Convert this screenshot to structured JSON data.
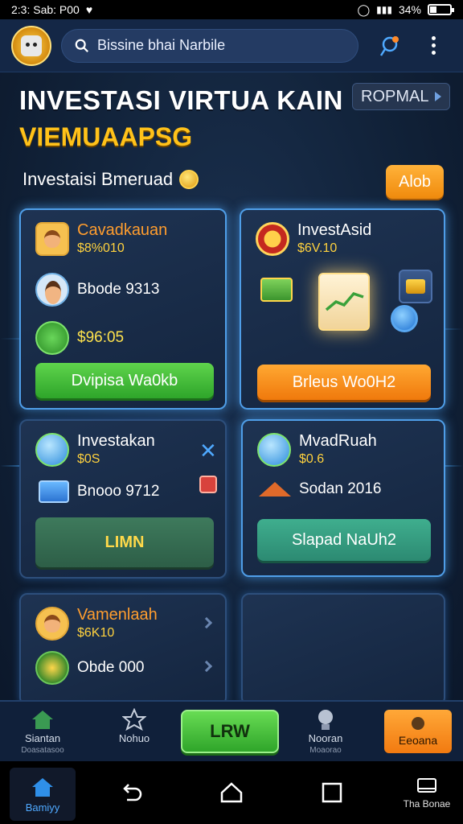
{
  "status_bar": {
    "left_text": "2:3: Sab: P00",
    "battery": "34%",
    "battery_level": 0.34
  },
  "header": {
    "search_placeholder": "Bissine bhai Narbile"
  },
  "hero": {
    "title": "INVESTASI VIRTUA KAIN",
    "subtitle": "VIEMUAAPSG",
    "mode_badge": "ROPMAL",
    "section_label": "Investaisi Bmeruad",
    "top_button": "Alob"
  },
  "cards": [
    {
      "name": "Cavadkauan",
      "value": "$8%010",
      "stat1": "Bbode 9313",
      "stat2": "$96:05",
      "button": "Dvipisa Wa0kb"
    },
    {
      "name": "InvestAsid",
      "value": "$6V.10",
      "button": "Brleus Wo0H2"
    },
    {
      "name": "Investakan",
      "value": "$0S",
      "stat1": "Bnooo 9712",
      "button": "LIMN"
    },
    {
      "name": "MvadRuah",
      "value": "$0.6",
      "stat1": "Sodan 2016",
      "button": "Slapad NaUh2"
    },
    {
      "name": "Vamenlaah",
      "value": "$6K10",
      "stat1": "Obde 000"
    }
  ],
  "game_nav": {
    "item1_label": "Siantan",
    "item1_sub": "Doasatasoo",
    "item2_label": "Nohuo",
    "center_button": "LRW",
    "item4_label": "Nooran",
    "item4_sub": "Moaorao",
    "right_button": "Eeoana"
  },
  "sys_nav": {
    "home_label": "Bamiyy",
    "right_label": "Tha Bonae"
  },
  "colors": {
    "accent_orange": "#f08a0c",
    "accent_green": "#2ea52a",
    "title_gold": "#ffc21a"
  }
}
